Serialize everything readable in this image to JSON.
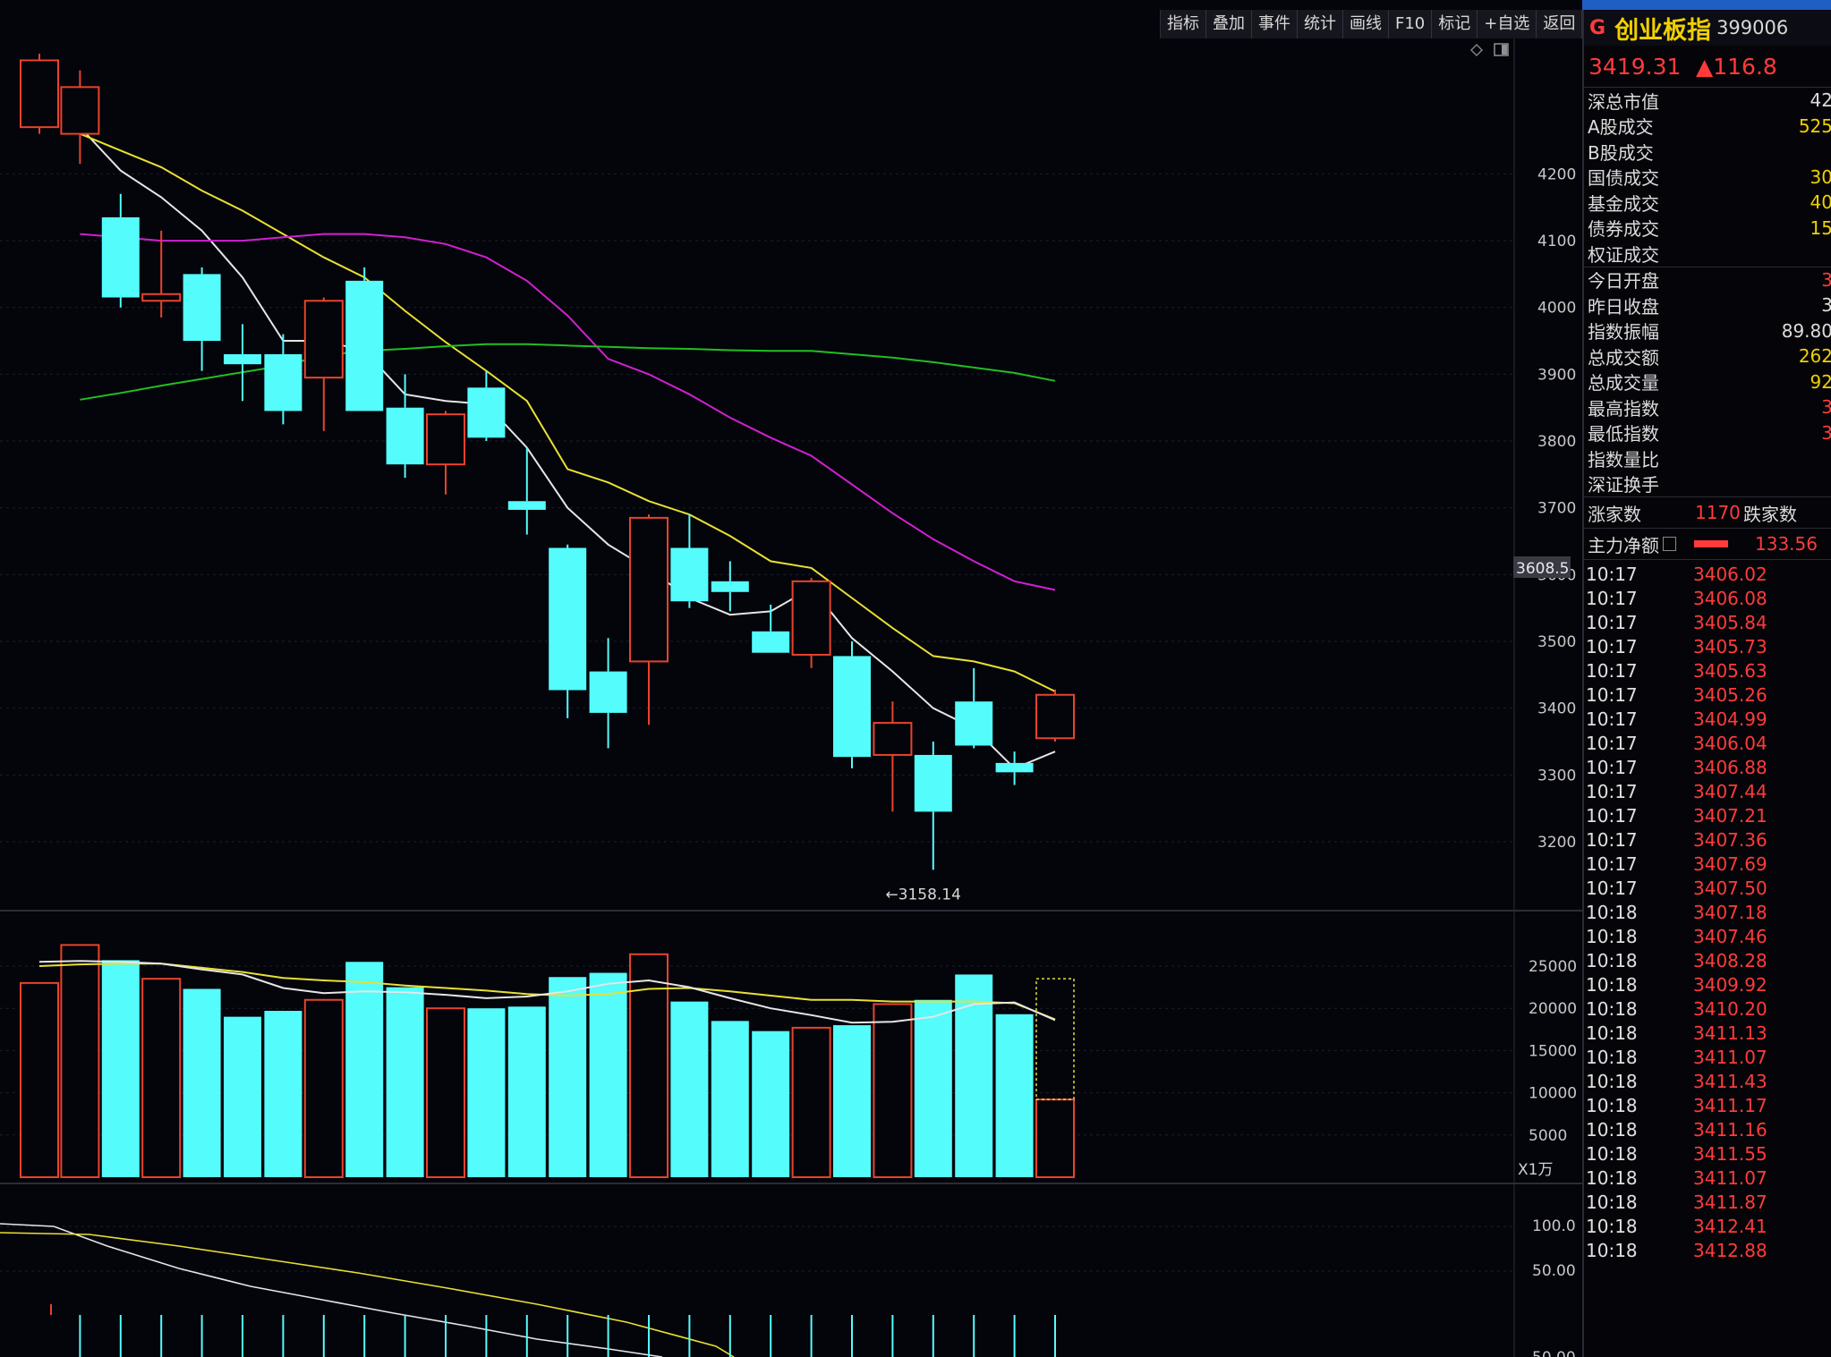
{
  "toolbar": {
    "items": [
      "指标",
      "叠加",
      "事件",
      "统计",
      "画线",
      "F10",
      "标记",
      "+自选",
      "返回"
    ]
  },
  "stock": {
    "flag": "G",
    "name": "创业板指",
    "code": "399006",
    "price": "3419.31",
    "change": "▲116.8"
  },
  "stats_group1": [
    {
      "label": "深总市值",
      "value": "42",
      "color": "#dcdcdc"
    },
    {
      "label": "A股成交",
      "value": "525",
      "color": "#f0d000"
    },
    {
      "label": "B股成交",
      "value": "",
      "color": "#f0d000"
    },
    {
      "label": "国债成交",
      "value": "30",
      "color": "#f0d000"
    },
    {
      "label": "基金成交",
      "value": "40",
      "color": "#f0d000"
    },
    {
      "label": "债券成交",
      "value": "15",
      "color": "#f0d000"
    },
    {
      "label": "权证成交",
      "value": "",
      "color": "#f0d000"
    }
  ],
  "stats_group2": [
    {
      "label": "今日开盘",
      "value": "3",
      "color": "#ff3b3b"
    },
    {
      "label": "昨日收盘",
      "value": "3",
      "color": "#dcdcdc"
    },
    {
      "label": "指数振幅",
      "value": "89.80",
      "color": "#dcdcdc"
    },
    {
      "label": "总成交额",
      "value": "262",
      "color": "#f0d000"
    },
    {
      "label": "总成交量",
      "value": "92",
      "color": "#f0d000"
    },
    {
      "label": "最高指数",
      "value": "3",
      "color": "#ff3b3b"
    },
    {
      "label": "最低指数",
      "value": "3",
      "color": "#ff3b3b"
    },
    {
      "label": "指数量比",
      "value": "",
      "color": "#dcdcdc"
    },
    {
      "label": "深证换手",
      "value": "",
      "color": "#dcdcdc"
    }
  ],
  "updown": {
    "up_label": "涨家数",
    "up_value": "1170",
    "down_label": "跌家数"
  },
  "main_force": {
    "label": "主力净额",
    "value": "133.56"
  },
  "ticks": [
    {
      "time": "10:17",
      "price": "3406.02"
    },
    {
      "time": "10:17",
      "price": "3406.08"
    },
    {
      "time": "10:17",
      "price": "3405.84"
    },
    {
      "time": "10:17",
      "price": "3405.73"
    },
    {
      "time": "10:17",
      "price": "3405.63"
    },
    {
      "time": "10:17",
      "price": "3405.26"
    },
    {
      "time": "10:17",
      "price": "3404.99"
    },
    {
      "time": "10:17",
      "price": "3406.04"
    },
    {
      "time": "10:17",
      "price": "3406.88"
    },
    {
      "time": "10:17",
      "price": "3407.44"
    },
    {
      "time": "10:17",
      "price": "3407.21"
    },
    {
      "time": "10:17",
      "price": "3407.36"
    },
    {
      "time": "10:17",
      "price": "3407.69"
    },
    {
      "time": "10:17",
      "price": "3407.50"
    },
    {
      "time": "10:18",
      "price": "3407.18"
    },
    {
      "time": "10:18",
      "price": "3407.46"
    },
    {
      "time": "10:18",
      "price": "3408.28"
    },
    {
      "time": "10:18",
      "price": "3409.92"
    },
    {
      "time": "10:18",
      "price": "3410.20"
    },
    {
      "time": "10:18",
      "price": "3411.13"
    },
    {
      "time": "10:18",
      "price": "3411.07"
    },
    {
      "time": "10:18",
      "price": "3411.43"
    },
    {
      "time": "10:18",
      "price": "3411.17"
    },
    {
      "time": "10:18",
      "price": "3411.16"
    },
    {
      "time": "10:18",
      "price": "3411.55"
    },
    {
      "time": "10:18",
      "price": "3411.07"
    },
    {
      "time": "10:18",
      "price": "3411.87"
    },
    {
      "time": "10:18",
      "price": "3412.41"
    },
    {
      "time": "10:18",
      "price": "3412.88"
    }
  ],
  "chart_data": {
    "type": "candlestick",
    "price_axis": {
      "ticks": [
        3200,
        3300,
        3400,
        3500,
        3600,
        3700,
        3800,
        3900,
        4000,
        4100,
        4200
      ],
      "range": [
        3100,
        4350
      ]
    },
    "current_price_label": "3608.5",
    "low_marker": {
      "index": 21,
      "label": "←3158.14",
      "value": 3158.14
    },
    "candles": [
      {
        "o": 4270,
        "c": 4370,
        "h": 4380,
        "l": 4260
      },
      {
        "o": 4260,
        "c": 4330,
        "h": 4355,
        "l": 4215
      },
      {
        "o": 4135,
        "c": 4015,
        "h": 4170,
        "l": 4000
      },
      {
        "o": 4010,
        "c": 4020,
        "h": 4115,
        "l": 3985
      },
      {
        "o": 4050,
        "c": 3950,
        "h": 4060,
        "l": 3905
      },
      {
        "o": 3930,
        "c": 3915,
        "h": 3975,
        "l": 3860
      },
      {
        "o": 3930,
        "c": 3845,
        "h": 3960,
        "l": 3825
      },
      {
        "o": 3895,
        "c": 4010,
        "h": 4015,
        "l": 3815
      },
      {
        "o": 4040,
        "c": 3845,
        "h": 4060,
        "l": 3845
      },
      {
        "o": 3850,
        "c": 3765,
        "h": 3900,
        "l": 3745
      },
      {
        "o": 3765,
        "c": 3840,
        "h": 3845,
        "l": 3720
      },
      {
        "o": 3880,
        "c": 3805,
        "h": 3905,
        "l": 3800
      },
      {
        "o": 3710,
        "c": 3697,
        "h": 3790,
        "l": 3660
      },
      {
        "o": 3640,
        "c": 3427,
        "h": 3645,
        "l": 3385
      },
      {
        "o": 3455,
        "c": 3393,
        "h": 3505,
        "l": 3340
      },
      {
        "o": 3470,
        "c": 3685,
        "h": 3690,
        "l": 3375
      },
      {
        "o": 3640,
        "c": 3560,
        "h": 3690,
        "l": 3550
      },
      {
        "o": 3590,
        "c": 3574,
        "h": 3620,
        "l": 3545
      },
      {
        "o": 3515,
        "c": 3483,
        "h": 3555,
        "l": 3483
      },
      {
        "o": 3480,
        "c": 3590,
        "h": 3595,
        "l": 3460
      },
      {
        "o": 3478,
        "c": 3327,
        "h": 3500,
        "l": 3310
      },
      {
        "o": 3330,
        "c": 3378,
        "h": 3410,
        "l": 3245
      },
      {
        "o": 3330,
        "c": 3245,
        "h": 3350,
        "l": 3158
      },
      {
        "o": 3410,
        "c": 3344,
        "h": 3460,
        "l": 3340
      },
      {
        "o": 3318,
        "c": 3304,
        "h": 3335,
        "l": 3285
      },
      {
        "o": 3355,
        "c": 3420,
        "h": 3428,
        "l": 3350
      }
    ],
    "ma_lines": [
      {
        "name": "MA5",
        "color": "#e6e6e6",
        "values": [
          null,
          4270,
          4205,
          4165,
          4115,
          4045,
          3950,
          3950,
          3935,
          3870,
          3860,
          3855,
          3790,
          3700,
          3645,
          3608,
          3565,
          3540,
          3545,
          3580,
          3505,
          3455,
          3400,
          3370,
          3310,
          3335
        ]
      },
      {
        "name": "MA10",
        "color": "#e8e032",
        "values": [
          null,
          4260,
          4235,
          4210,
          4175,
          4145,
          4110,
          4075,
          4045,
          3995,
          3948,
          3905,
          3860,
          3758,
          3738,
          3710,
          3690,
          3658,
          3620,
          3610,
          3565,
          3520,
          3478,
          3470,
          3455,
          3425
        ]
      },
      {
        "name": "MA20",
        "color": "#d020d0",
        "values": [
          null,
          4110,
          4105,
          4100,
          4100,
          4100,
          4105,
          4110,
          4110,
          4105,
          4095,
          4075,
          4040,
          3988,
          3923,
          3900,
          3870,
          3835,
          3805,
          3778,
          3735,
          3692,
          3653,
          3620,
          3590,
          3577
        ]
      },
      {
        "name": "MA60",
        "color": "#20c020",
        "values": [
          null,
          3862,
          3872,
          3883,
          3893,
          3903,
          3913,
          3928,
          3935,
          3938,
          3942,
          3945,
          3945,
          3943,
          3941,
          3939,
          3938,
          3936,
          3935,
          3935,
          3930,
          3925,
          3918,
          3910,
          3902,
          3890
        ]
      }
    ],
    "volume_axis": {
      "ticks": [
        5000,
        10000,
        15000,
        20000,
        25000
      ],
      "range": [
        0,
        27000
      ],
      "unit_label": "X1万"
    },
    "volumes": [
      23000,
      27500,
      25700,
      23500,
      22300,
      19000,
      19700,
      21000,
      25500,
      22500,
      20000,
      20000,
      20200,
      23700,
      24200,
      26400,
      20800,
      18500,
      17300,
      17700,
      18000,
      20500,
      21000,
      24000,
      19300,
      9200
    ],
    "volume_partial_estimate": 23500,
    "volume_ma": [
      {
        "name": "VMA5",
        "color": "#e8e032",
        "values": [
          25000,
          25200,
          25300,
          25300,
          24800,
          24300,
          23600,
          23300,
          23100,
          22700,
          22400,
          22100,
          21700,
          21500,
          21700,
          22300,
          22400,
          22000,
          21500,
          21000,
          21000,
          20800,
          20800,
          20800,
          20600,
          18700
        ]
      },
      {
        "name": "VMA10",
        "color": "#e6e6e6",
        "values": [
          25500,
          25600,
          25500,
          25300,
          24600,
          24000,
          22400,
          21800,
          22000,
          21900,
          21600,
          21200,
          21400,
          22000,
          22900,
          23300,
          22500,
          21200,
          20000,
          19200,
          18300,
          18400,
          19000,
          20500,
          20700,
          18600
        ]
      }
    ],
    "osc_axis": {
      "ticks": [
        "100.0",
        "50.00"
      ]
    },
    "osc_partial_tick": "50.00"
  }
}
